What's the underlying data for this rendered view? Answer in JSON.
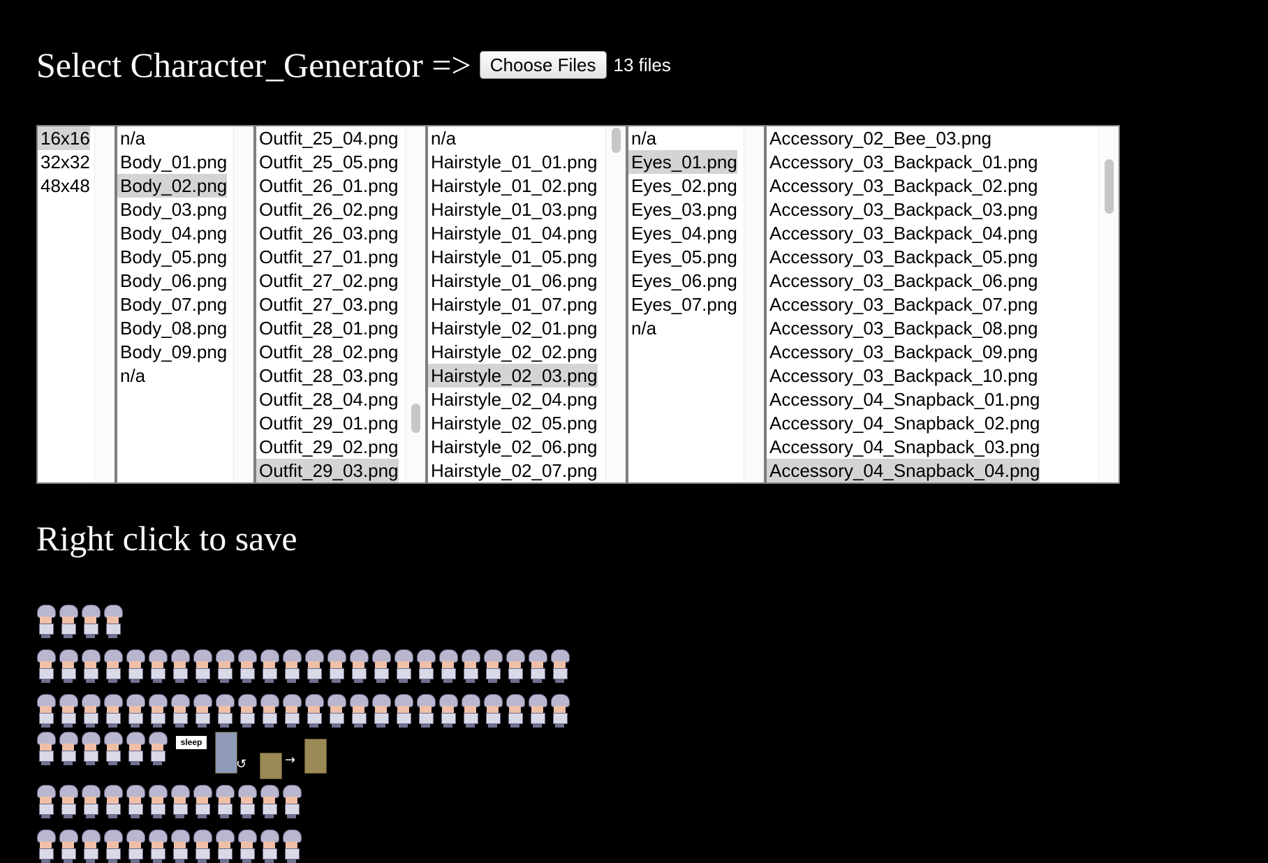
{
  "header": {
    "title": "Select Character_Generator =>",
    "choose_files_label": "Choose Files",
    "file_status": "13 files"
  },
  "selects": [
    {
      "name": "size",
      "items": [
        "16x16",
        "32x32",
        "48x48"
      ],
      "selected": "16x16"
    },
    {
      "name": "body",
      "items": [
        "n/a",
        "Body_01.png",
        "Body_02.png",
        "Body_03.png",
        "Body_04.png",
        "Body_05.png",
        "Body_06.png",
        "Body_07.png",
        "Body_08.png",
        "Body_09.png",
        "n/a"
      ],
      "selected": "Body_02.png"
    },
    {
      "name": "outfit",
      "items": [
        "Outfit_25_04.png",
        "Outfit_25_05.png",
        "Outfit_26_01.png",
        "Outfit_26_02.png",
        "Outfit_26_03.png",
        "Outfit_27_01.png",
        "Outfit_27_02.png",
        "Outfit_27_03.png",
        "Outfit_28_01.png",
        "Outfit_28_02.png",
        "Outfit_28_03.png",
        "Outfit_28_04.png",
        "Outfit_29_01.png",
        "Outfit_29_02.png",
        "Outfit_29_03.png"
      ],
      "selected": "Outfit_29_03.png"
    },
    {
      "name": "hairstyle",
      "items": [
        "n/a",
        "Hairstyle_01_01.png",
        "Hairstyle_01_02.png",
        "Hairstyle_01_03.png",
        "Hairstyle_01_04.png",
        "Hairstyle_01_05.png",
        "Hairstyle_01_06.png",
        "Hairstyle_01_07.png",
        "Hairstyle_02_01.png",
        "Hairstyle_02_02.png",
        "Hairstyle_02_03.png",
        "Hairstyle_02_04.png",
        "Hairstyle_02_05.png",
        "Hairstyle_02_06.png",
        "Hairstyle_02_07.png"
      ],
      "selected": "Hairstyle_02_03.png"
    },
    {
      "name": "eyes",
      "items": [
        "n/a",
        "Eyes_01.png",
        "Eyes_02.png",
        "Eyes_03.png",
        "Eyes_04.png",
        "Eyes_05.png",
        "Eyes_06.png",
        "Eyes_07.png",
        "n/a"
      ],
      "selected": "Eyes_01.png"
    },
    {
      "name": "accessory",
      "items": [
        "Accessory_02_Bee_03.png",
        "Accessory_03_Backpack_01.png",
        "Accessory_03_Backpack_02.png",
        "Accessory_03_Backpack_03.png",
        "Accessory_03_Backpack_04.png",
        "Accessory_03_Backpack_05.png",
        "Accessory_03_Backpack_06.png",
        "Accessory_03_Backpack_07.png",
        "Accessory_03_Backpack_08.png",
        "Accessory_03_Backpack_09.png",
        "Accessory_03_Backpack_10.png",
        "Accessory_04_Snapback_01.png",
        "Accessory_04_Snapback_02.png",
        "Accessory_04_Snapback_03.png",
        "Accessory_04_Snapback_04.png"
      ],
      "selected": "Accessory_04_Snapback_04.png"
    }
  ],
  "save_heading": "Right click to save",
  "sprite_sheet": {
    "sleep_label": "sleep"
  },
  "colors": {
    "background": "#000000",
    "selected_option": "#d4d4d4"
  }
}
